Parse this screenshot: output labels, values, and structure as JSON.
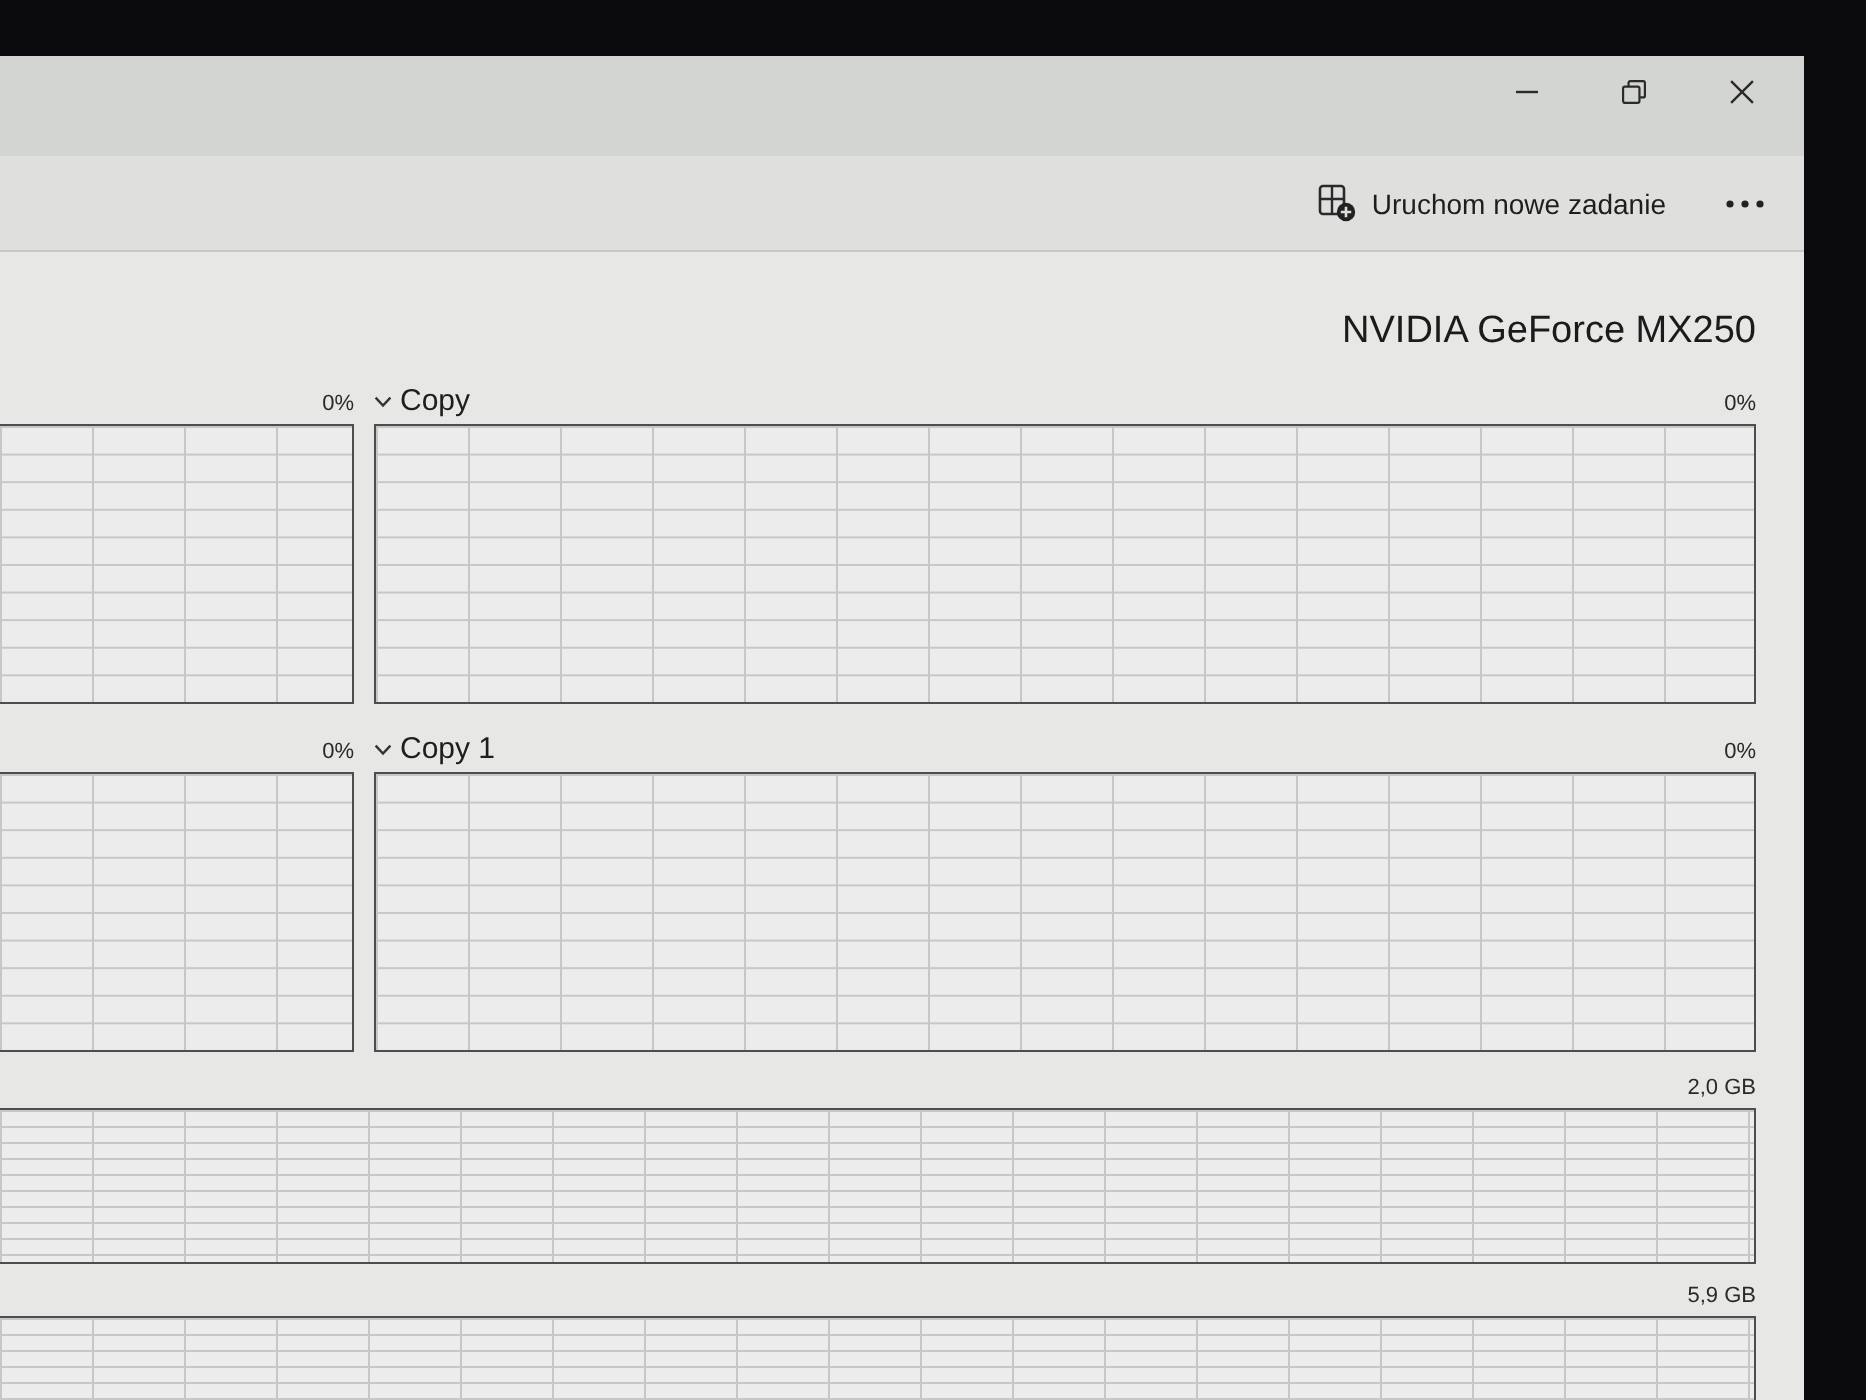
{
  "toolbar": {
    "new_task_button": "Uruchom nowe zadanie"
  },
  "gpu": {
    "name": "NVIDIA GeForce MX250"
  },
  "engine_graphs": [
    {
      "scale_max": "0%"
    },
    {
      "name": "Copy",
      "scale_max": "0%"
    },
    {
      "scale_max": "0%"
    },
    {
      "name": "Copy 1",
      "scale_max": "0%"
    }
  ],
  "memory_graphs": [
    {
      "scale_max": "2,0 GB"
    },
    {
      "scale_max": "5,9 GB"
    }
  ]
}
